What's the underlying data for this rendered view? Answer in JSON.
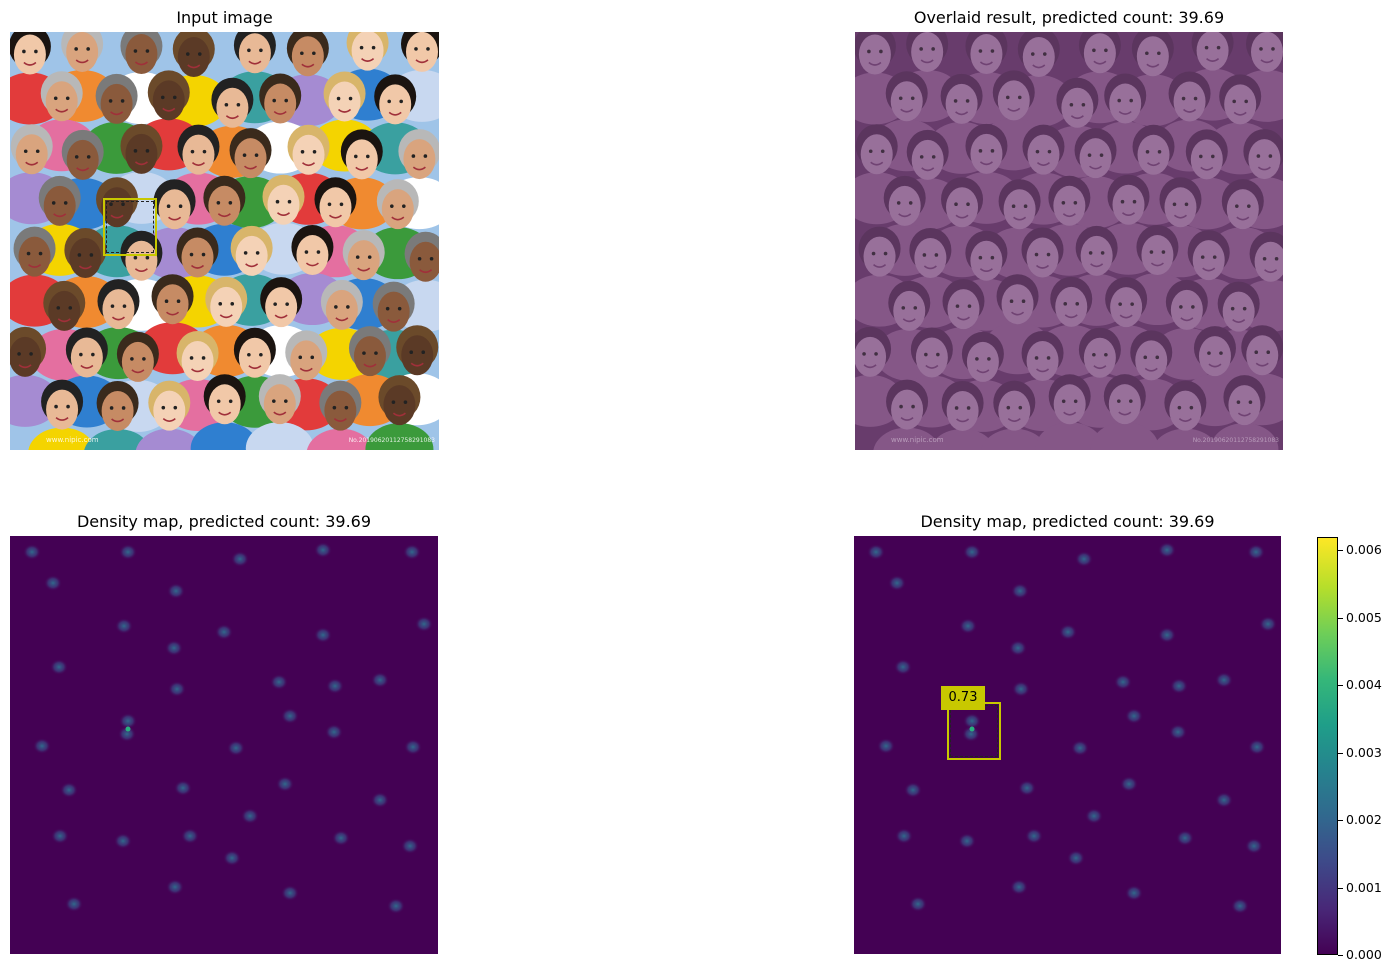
{
  "titles": {
    "input": "Input image",
    "overlaid": "Overlaid result, predicted count: 39.69",
    "density_left": "Density map, predicted count: 39.69",
    "density_right": "Density map, predicted count: 39.69"
  },
  "box_label": "0.73",
  "watermark": {
    "site": "www.nipic.com",
    "id": "No.20190620112758291083"
  },
  "colors": {
    "viridis_low": "#440154",
    "viridis_high": "#fde725",
    "box_yellow": "#c8c800",
    "overlay_purple": "#7c4a7f"
  },
  "chart_data": {
    "type": "heatmap",
    "colormap": "viridis",
    "predicted_count": 39.69,
    "box_score": 0.73,
    "colorbar": {
      "range": [
        0.0,
        0.0062
      ],
      "ticks": [
        "0.000",
        "0.001",
        "0.002",
        "0.003",
        "0.004",
        "0.005",
        "0.006"
      ]
    }
  }
}
